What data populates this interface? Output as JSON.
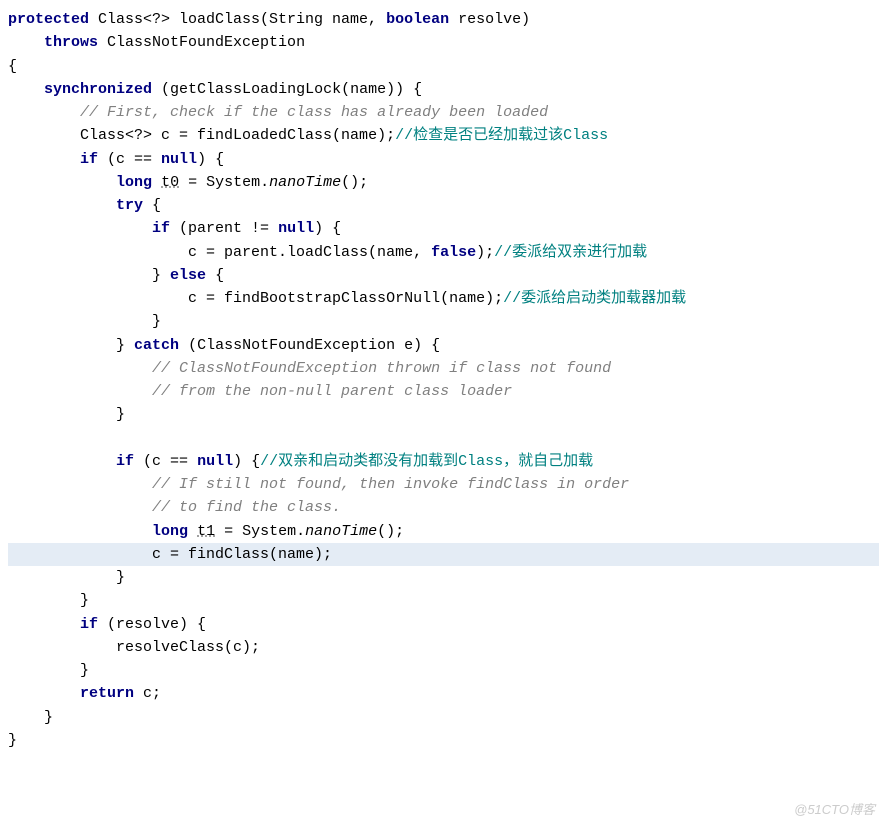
{
  "code": {
    "l1": {
      "kw1": "protected",
      "t1": " Class<?> loadClass(String name, ",
      "kw2": "boolean",
      "t2": " resolve)"
    },
    "l2": {
      "kw1": "throws",
      "t1": " ClassNotFoundException"
    },
    "l3": {
      "t": "{"
    },
    "l4": {
      "kw1": "synchronized",
      "t1": " (getClassLoadingLock(name)) {"
    },
    "l5": {
      "cmt": "// First, check if the class has already been loaded"
    },
    "l6": {
      "t1": "Class<?> c = findLoadedClass(name);",
      "cmt": "//检查是否已经加载过该Class"
    },
    "l7": {
      "kw1": "if",
      "t1": " (c == ",
      "kw2": "null",
      "t2": ") {"
    },
    "l8": {
      "kw1": "long",
      "sp": " ",
      "var": "t0",
      "t1": " = System.",
      "m": "nanoTime",
      "t2": "();"
    },
    "l9": {
      "kw1": "try",
      "t1": " {"
    },
    "l10": {
      "kw1": "if",
      "t1": " (parent != ",
      "kw2": "null",
      "t2": ") {"
    },
    "l11": {
      "t1": "c = parent.loadClass(name, ",
      "kw1": "false",
      "t2": ");",
      "cmt": "//委派给双亲进行加载"
    },
    "l12": {
      "t1": "} ",
      "kw1": "else",
      "t2": " {"
    },
    "l13": {
      "t1": "c = findBootstrapClassOrNull(name);",
      "cmt": "//委派给启动类加载器加载"
    },
    "l14": {
      "t": "}"
    },
    "l15": {
      "t1": "} ",
      "kw1": "catch",
      "t2": " (ClassNotFoundException e) {"
    },
    "l16": {
      "cmt": "// ClassNotFoundException thrown if class not found"
    },
    "l17": {
      "cmt": "// from the non-null parent class loader"
    },
    "l18": {
      "t": "}"
    },
    "l19": {
      "t": ""
    },
    "l20": {
      "kw1": "if",
      "t1": " (c == ",
      "kw2": "null",
      "t2": ") {",
      "cmt": "//双亲和启动类都没有加载到Class，就自己加载"
    },
    "l21": {
      "cmt": "// If still not found, then invoke findClass in order"
    },
    "l22": {
      "cmt": "// to find the class."
    },
    "l23": {
      "kw1": "long",
      "sp": " ",
      "var": "t1",
      "t1": " = System.",
      "m": "nanoTime",
      "t2": "();"
    },
    "l24": {
      "t": "c = findClass(name);"
    },
    "l25": {
      "t": "}"
    },
    "l26": {
      "t": "}"
    },
    "l27": {
      "kw1": "if",
      "t1": " (resolve) {"
    },
    "l28": {
      "t": "resolveClass(c);"
    },
    "l29": {
      "t": "}"
    },
    "l30": {
      "kw1": "return",
      "t1": " c;"
    },
    "l31": {
      "t": "}"
    },
    "l32": {
      "t": "}"
    }
  },
  "watermark": "@51CTO博客"
}
